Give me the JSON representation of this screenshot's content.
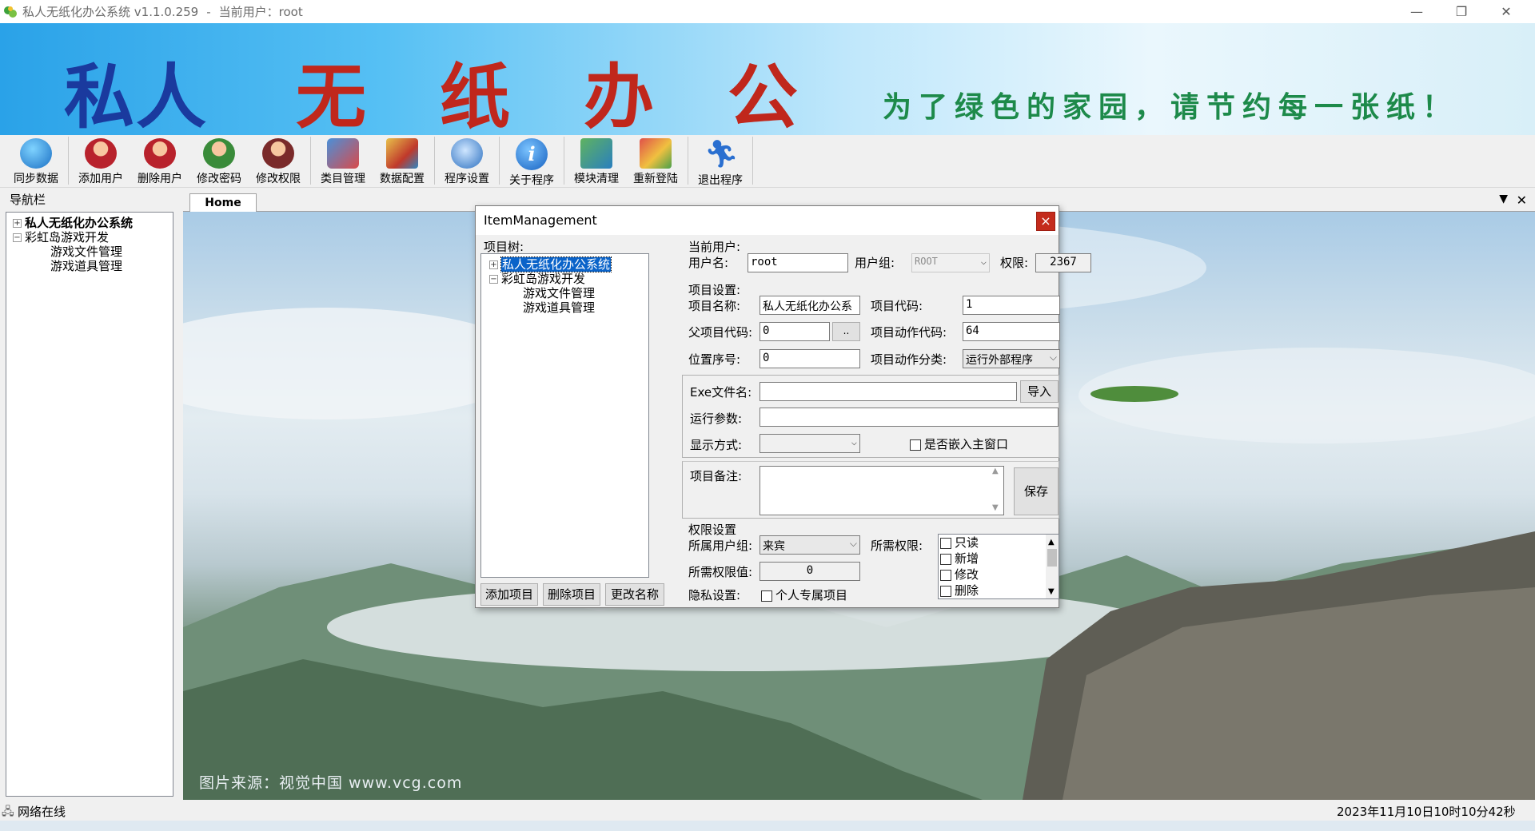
{
  "window": {
    "title": "私人无纸化办公系统 v1.1.0.259",
    "user_sep": "-",
    "user_prefix": "当前用户：",
    "user": "root"
  },
  "banner": {
    "title_chars": [
      "私人",
      "无",
      "纸",
      "办",
      "公"
    ],
    "slogan": "为了绿色的家园，请节约每一张纸！"
  },
  "toolbar": [
    {
      "label": "同步数据",
      "icon": "sync-globe-icon"
    },
    {
      "label": "添加用户",
      "icon": "add-user-icon"
    },
    {
      "label": "删除用户",
      "icon": "delete-user-icon"
    },
    {
      "label": "修改密码",
      "icon": "change-password-icon"
    },
    {
      "label": "修改权限",
      "icon": "change-permission-icon"
    },
    {
      "label": "类目管理",
      "icon": "category-icon"
    },
    {
      "label": "数据配置",
      "icon": "data-config-icon"
    },
    {
      "label": "程序设置",
      "icon": "settings-icon"
    },
    {
      "label": "关于程序",
      "icon": "info-icon"
    },
    {
      "label": "模块清理",
      "icon": "cleanup-icon"
    },
    {
      "label": "重新登陆",
      "icon": "relogin-icon"
    },
    {
      "label": "退出程序",
      "icon": "exit-runner-icon"
    }
  ],
  "nav": {
    "header": "导航栏",
    "root": "私人无纸化办公系统",
    "group": "彩虹岛游戏开发",
    "children": [
      "游戏文件管理",
      "游戏道具管理"
    ]
  },
  "tabs": {
    "home": "Home"
  },
  "content": {
    "credit": "图片来源：视觉中国 www.vcg.com"
  },
  "statusbar": {
    "network": "网络在线",
    "datetime": "2023年11月10日10时10分42秒"
  },
  "dialog": {
    "title": "ItemManagement",
    "close": "×",
    "tree_label": "项目树:",
    "tree": {
      "root": "私人无纸化办公系统",
      "group": "彩虹岛游戏开发",
      "children": [
        "游戏文件管理",
        "游戏道具管理"
      ]
    },
    "buttons": {
      "add": "添加项目",
      "delete": "删除项目",
      "rename": "更改名称",
      "import": "导入",
      "save": "保存",
      "browse": ".."
    },
    "current_user": {
      "section": "当前用户:",
      "username_label": "用户名:",
      "username": "root",
      "group_label": "用户组:",
      "group": "ROOT",
      "perm_label": "权限:",
      "perm": "2367"
    },
    "item": {
      "section": "项目设置:",
      "name_label": "项目名称:",
      "name": "私人无纸化办公系",
      "code_label": "项目代码:",
      "code": "1",
      "parent_label": "父项目代码:",
      "parent": "0",
      "action_code_label": "项目动作代码:",
      "action_code": "64",
      "order_label": "位置序号:",
      "order": "0",
      "action_type_label": "项目动作分类:",
      "action_type": "运行外部程序"
    },
    "exe": {
      "file_label": "Exe文件名:",
      "file": "",
      "args_label": "运行参数:",
      "args": "",
      "display_label": "显示方式:",
      "display": "",
      "embed_label": "是否嵌入主窗口",
      "embed_checked": false
    },
    "remark_label": "项目备注:",
    "remark": "",
    "perm": {
      "section": "权限设置",
      "user_group_label": "所属用户组:",
      "user_group": "来宾",
      "required_label": "所需权限:",
      "value_label": "所需权限值:",
      "value": "0",
      "privacy_label": "隐私设置:",
      "private_label": "个人专属项目",
      "private_checked": false,
      "options": [
        "只读",
        "新增",
        "修改",
        "删除"
      ]
    }
  }
}
